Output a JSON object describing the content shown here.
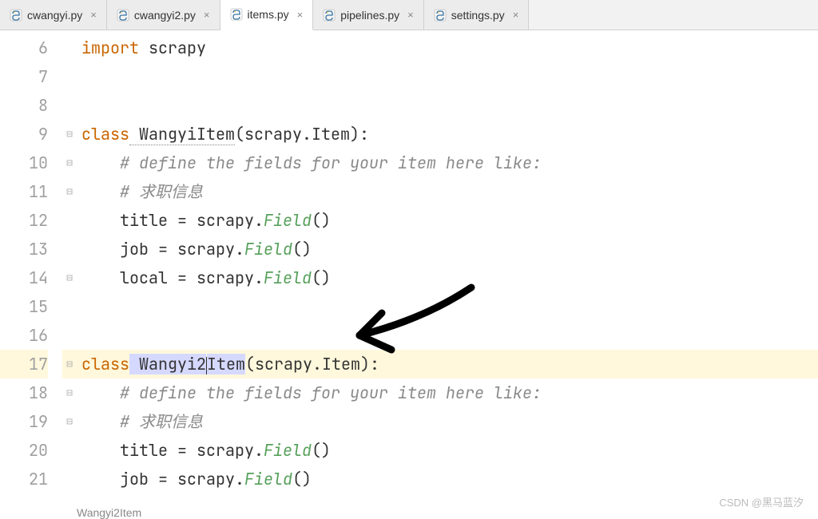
{
  "tabs": [
    {
      "label": "cwangyi.py",
      "active": false
    },
    {
      "label": "cwangyi2.py",
      "active": false
    },
    {
      "label": "items.py",
      "active": true
    },
    {
      "label": "pipelines.py",
      "active": false
    },
    {
      "label": "settings.py",
      "active": false
    }
  ],
  "line_numbers": [
    "6",
    "7",
    "8",
    "9",
    "10",
    "11",
    "12",
    "13",
    "14",
    "15",
    "16",
    "17",
    "18",
    "19",
    "20",
    "21"
  ],
  "code": {
    "l6": {
      "kw": "import",
      "mod": " scrapy"
    },
    "l9": {
      "kw": "class",
      "name": " WangyiItem",
      "base": "(scrapy.Item):"
    },
    "l10": {
      "cm": "    # define the fields for your item here like:"
    },
    "l11": {
      "cm": "    # 求职信息"
    },
    "l12": {
      "lhs": "    title = scrapy.",
      "fn": "Field",
      "rhs": "()"
    },
    "l13": {
      "lhs": "    job = scrapy.",
      "fn": "Field",
      "rhs": "()"
    },
    "l14": {
      "lhs": "    local = scrapy.",
      "fn": "Field",
      "rhs": "()"
    },
    "l17": {
      "kw": "class",
      "name_a": " Wangyi2",
      "name_b": "Item",
      "base": "(scrapy.Item):"
    },
    "l18": {
      "cm": "    # define the fields for your item here like:"
    },
    "l19": {
      "cm": "    # 求职信息"
    },
    "l20": {
      "lhs": "    title = scrapy.",
      "fn": "Field",
      "rhs": "()"
    },
    "l21": {
      "lhs": "    job = scrapy.",
      "fn": "Field",
      "rhs": "()"
    }
  },
  "breadcrumb": "Wangyi2Item",
  "watermark": "CSDN @黑马蓝汐",
  "icons": {
    "close": "×"
  }
}
